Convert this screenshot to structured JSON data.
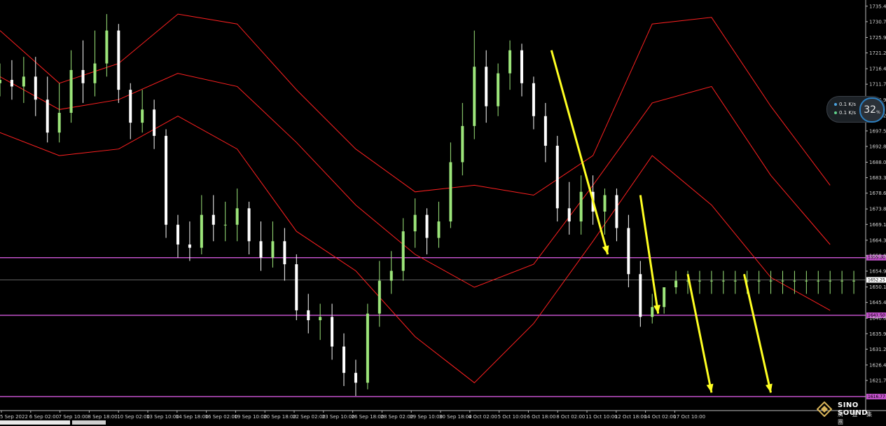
{
  "chart_data": {
    "type": "candlestick",
    "title": "",
    "xlabel": "",
    "ylabel": "",
    "ylim": [
      1616.8,
      1736.0
    ],
    "grid": false,
    "y_ticks": [
      "1735.40",
      "1730.70",
      "1725.90",
      "1721.20",
      "1716.40",
      "1711.70",
      "1706.90",
      "1702.20",
      "1697.50",
      "1692.80",
      "1688.00",
      "1683.30",
      "1678.60",
      "1673.80",
      "1669.10",
      "1664.30",
      "1659.60",
      "1654.90",
      "1650.10",
      "1645.40",
      "1640.60",
      "1635.90",
      "1631.20",
      "1626.40",
      "1621.70"
    ],
    "y_tick_values": [
      1735.4,
      1730.7,
      1725.9,
      1721.2,
      1716.4,
      1711.7,
      1706.9,
      1702.2,
      1697.5,
      1692.8,
      1688.0,
      1683.3,
      1678.6,
      1673.8,
      1669.1,
      1664.3,
      1659.6,
      1654.9,
      1650.1,
      1645.4,
      1640.6,
      1635.9,
      1631.2,
      1626.4,
      1621.7
    ],
    "x_ticks": [
      "5 Sep 2022",
      "6 Sep 02:00",
      "7 Sep 10:00",
      "8 Sep 18:00",
      "10 Sep 02:00",
      "13 Sep 10:00",
      "14 Sep 18:00",
      "16 Sep 02:00",
      "19 Sep 10:00",
      "20 Sep 18:00",
      "22 Sep 02:00",
      "23 Sep 10:00",
      "26 Sep 18:00",
      "28 Sep 02:00",
      "29 Sep 10:00",
      "30 Sep 18:00",
      "4 Oct 02:00",
      "5 Oct 10:00",
      "6 Oct 18:00",
      "8 Oct 02:00",
      "11 Oct 10:00",
      "12 Oct 18:00",
      "14 Oct 02:00",
      "17 Oct 10:00"
    ],
    "x_range_bars": [
      0,
      292
    ],
    "current_price": "1652.25",
    "horizontal_levels": [
      {
        "price": 1659.0,
        "label": "1659.00"
      },
      {
        "price": 1641.5,
        "label": "1641.50"
      },
      {
        "price": 1616.8,
        "label": "1616.77"
      }
    ],
    "level_color": "#c050c8",
    "bollinger_color": "#ff2020",
    "candle_up_color": "#9ce57a",
    "candle_down_color": "#ffffff",
    "series": [
      {
        "name": "bb_upper",
        "bars": [
          0,
          20,
          40,
          60,
          80,
          100,
          120,
          140,
          160,
          180,
          200,
          220,
          240,
          260,
          280
        ],
        "values": [
          1728,
          1712,
          1718,
          1733,
          1730,
          1710,
          1692,
          1679,
          1681,
          1678,
          1690,
          1730,
          1732,
          1705,
          1681
        ]
      },
      {
        "name": "bb_mid",
        "bars": [
          0,
          20,
          40,
          60,
          80,
          100,
          120,
          140,
          160,
          180,
          200,
          220,
          240,
          260,
          280
        ],
        "values": [
          1714,
          1704,
          1707,
          1715,
          1711,
          1694,
          1675,
          1660,
          1650,
          1657,
          1681,
          1706,
          1711,
          1684,
          1663
        ]
      },
      {
        "name": "bb_lower",
        "bars": [
          0,
          20,
          40,
          60,
          80,
          100,
          120,
          140,
          160,
          180,
          200,
          220,
          240,
          260,
          280
        ],
        "values": [
          1697,
          1690,
          1692,
          1702,
          1692,
          1667,
          1655,
          1635,
          1621,
          1639,
          1664,
          1690,
          1675,
          1653,
          1643
        ]
      },
      {
        "name": "candles_ohlc",
        "bars": [
          0,
          4,
          8,
          12,
          16,
          20,
          24,
          28,
          32,
          36,
          40,
          44,
          48,
          52,
          56,
          60,
          64,
          68,
          72,
          76,
          80,
          84,
          88,
          92,
          96,
          100,
          104,
          108,
          112,
          116,
          120,
          124,
          128,
          132,
          136,
          140,
          144,
          148,
          152,
          156,
          160,
          164,
          168,
          172,
          176,
          180,
          184,
          188,
          192,
          196,
          200,
          204,
          208,
          212,
          216,
          220,
          224,
          228,
          232,
          236,
          240,
          244,
          248,
          252,
          256,
          260,
          264,
          268,
          272,
          276,
          280,
          284,
          288
        ],
        "open": [
          1712,
          1713,
          1711,
          1714,
          1707,
          1697,
          1703,
          1716,
          1712,
          1718,
          1728,
          1710,
          1700,
          1704,
          1696,
          1669,
          1663,
          1662,
          1672,
          1669,
          1669,
          1674,
          1664,
          1659,
          1664,
          1657,
          1643,
          1640,
          1641,
          1632,
          1624,
          1621,
          1642,
          1652,
          1655,
          1667,
          1672,
          1665,
          1670,
          1688,
          1699,
          1717,
          1705,
          1715,
          1722,
          1712,
          1702,
          1693,
          1674,
          1670,
          1679,
          1673,
          1678,
          1668,
          1654,
          1641,
          1644,
          1650,
          1652,
          1652,
          1652,
          1652,
          1652,
          1652,
          1652,
          1652,
          1652,
          1652,
          1652,
          1652,
          1652,
          1652,
          1652
        ],
        "close": [
          1713,
          1711,
          1714,
          1707,
          1697,
          1703,
          1716,
          1712,
          1718,
          1728,
          1710,
          1700,
          1704,
          1696,
          1669,
          1663,
          1662,
          1672,
          1669,
          1669,
          1674,
          1664,
          1659,
          1664,
          1657,
          1643,
          1640,
          1641,
          1632,
          1624,
          1621,
          1642,
          1652,
          1655,
          1667,
          1672,
          1665,
          1670,
          1688,
          1699,
          1717,
          1705,
          1715,
          1722,
          1712,
          1702,
          1693,
          1674,
          1670,
          1679,
          1673,
          1678,
          1668,
          1654,
          1641,
          1644,
          1650,
          1652,
          1652,
          1652,
          1652,
          1652,
          1652,
          1652,
          1652,
          1652,
          1652,
          1652,
          1652,
          1652,
          1652,
          1652,
          1652
        ],
        "high": [
          1718,
          1719,
          1720,
          1720,
          1714,
          1712,
          1722,
          1725,
          1728,
          1733,
          1730,
          1712,
          1710,
          1707,
          1698,
          1672,
          1670,
          1678,
          1678,
          1676,
          1680,
          1676,
          1670,
          1670,
          1668,
          1660,
          1648,
          1645,
          1645,
          1636,
          1628,
          1645,
          1658,
          1661,
          1671,
          1677,
          1674,
          1676,
          1694,
          1706,
          1728,
          1722,
          1718,
          1725,
          1724,
          1714,
          1706,
          1696,
          1682,
          1684,
          1684,
          1680,
          1680,
          1672,
          1658,
          1648,
          1650,
          1655,
          1655,
          1655,
          1655,
          1655,
          1655,
          1655,
          1655,
          1655,
          1655,
          1655,
          1655,
          1655,
          1655,
          1655,
          1655
        ],
        "low": [
          1708,
          1707,
          1706,
          1702,
          1694,
          1694,
          1700,
          1706,
          1708,
          1714,
          1706,
          1695,
          1697,
          1692,
          1665,
          1659,
          1658,
          1660,
          1664,
          1664,
          1664,
          1660,
          1655,
          1656,
          1652,
          1640,
          1636,
          1634,
          1628,
          1620,
          1617,
          1619,
          1638,
          1648,
          1652,
          1662,
          1660,
          1662,
          1668,
          1684,
          1695,
          1700,
          1702,
          1710,
          1708,
          1698,
          1688,
          1670,
          1666,
          1666,
          1669,
          1666,
          1664,
          1650,
          1638,
          1639,
          1642,
          1648,
          1648,
          1648,
          1648,
          1648,
          1648,
          1648,
          1648,
          1648,
          1648,
          1648,
          1648,
          1648,
          1648,
          1648,
          1648
        ]
      },
      {
        "name": "forecast_arrows",
        "bars": [
          186,
          205,
          216,
          222,
          232,
          240,
          251,
          260
        ],
        "values": [
          1722,
          1660,
          1678,
          1642,
          1654,
          1618,
          1654,
          1618
        ]
      }
    ]
  },
  "gauge": {
    "percent": "32",
    "percent_sign": "%",
    "row1_value": "0.1",
    "row1_unit": "K/s",
    "row2_value": "0.1",
    "row2_unit": "K/s"
  },
  "logo": {
    "text": "SINO SOUND",
    "sub": "濟 豐 集 團"
  }
}
